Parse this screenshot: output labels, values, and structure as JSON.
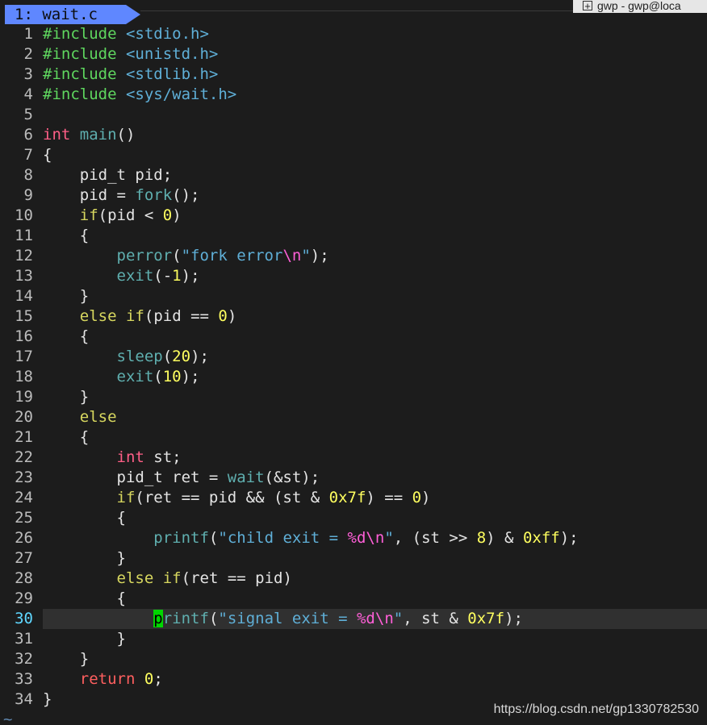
{
  "tab": {
    "label": "1: wait.c"
  },
  "window_title": "gwp - gwp@loca",
  "code_lines": [
    {
      "n": "1",
      "text": "#include <stdio.h>"
    },
    {
      "n": "2",
      "text": "#include <unistd.h>"
    },
    {
      "n": "3",
      "text": "#include <stdlib.h>"
    },
    {
      "n": "4",
      "text": "#include <sys/wait.h>"
    },
    {
      "n": "5",
      "text": ""
    },
    {
      "n": "6",
      "text": "int main()"
    },
    {
      "n": "7",
      "text": "{"
    },
    {
      "n": "8",
      "text": "    pid_t pid;"
    },
    {
      "n": "9",
      "text": "    pid = fork();"
    },
    {
      "n": "10",
      "text": "    if(pid < 0)"
    },
    {
      "n": "11",
      "text": "    {"
    },
    {
      "n": "12",
      "text": "        perror(\"fork error\\n\");"
    },
    {
      "n": "13",
      "text": "        exit(-1);"
    },
    {
      "n": "14",
      "text": "    }"
    },
    {
      "n": "15",
      "text": "    else if(pid == 0)"
    },
    {
      "n": "16",
      "text": "    {"
    },
    {
      "n": "17",
      "text": "        sleep(20);"
    },
    {
      "n": "18",
      "text": "        exit(10);"
    },
    {
      "n": "19",
      "text": "    }"
    },
    {
      "n": "20",
      "text": "    else"
    },
    {
      "n": "21",
      "text": "    {"
    },
    {
      "n": "22",
      "text": "        int st;"
    },
    {
      "n": "23",
      "text": "        pid_t ret = wait(&st);"
    },
    {
      "n": "24",
      "text": "        if(ret == pid && (st & 0x7f) == 0)"
    },
    {
      "n": "25",
      "text": "        {"
    },
    {
      "n": "26",
      "text": "            printf(\"child exit = %d\\n\", (st >> 8) & 0xff);"
    },
    {
      "n": "27",
      "text": "        }"
    },
    {
      "n": "28",
      "text": "        else if(ret == pid)"
    },
    {
      "n": "29",
      "text": "        {"
    },
    {
      "n": "30",
      "text": "            printf(\"signal exit = %d\\n\", st & 0x7f);"
    },
    {
      "n": "31",
      "text": "        }"
    },
    {
      "n": "32",
      "text": "    }"
    },
    {
      "n": "33",
      "text": "    return 0;"
    },
    {
      "n": "34",
      "text": "}"
    }
  ],
  "cursor_line": "30",
  "empty_line_marker": "~",
  "watermark": "https://blog.csdn.net/gp1330782530",
  "colors": {
    "background": "#1c1c1c",
    "tab_active": "#5f87ff",
    "cursor": "#00d700",
    "cursorline": "#303030"
  },
  "icons": {
    "title_chip_icon": "plus-box-icon"
  }
}
